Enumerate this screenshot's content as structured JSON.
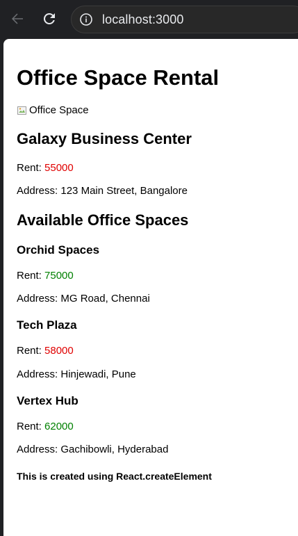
{
  "browser": {
    "url": "localhost:3000",
    "icons": {
      "back": "arrow-left-icon",
      "reload": "reload-icon",
      "site_info": "info-icon"
    }
  },
  "page": {
    "title": "Office Space Rental",
    "image_alt": "Office Space",
    "featured": {
      "name": "Galaxy Business Center",
      "rent_label": "Rent: ",
      "rent": "55000",
      "rent_color": "#e00000",
      "address_label": "Address: ",
      "address": "123 Main Street, Bangalore"
    },
    "available_heading": "Available Office Spaces",
    "offices": [
      {
        "name": "Orchid Spaces",
        "rent_label": "Rent: ",
        "rent": "75000",
        "rent_color": "#008000",
        "address_label": "Address: ",
        "address": "MG Road, Chennai"
      },
      {
        "name": "Tech Plaza",
        "rent_label": "Rent: ",
        "rent": "58000",
        "rent_color": "#e00000",
        "address_label": "Address: ",
        "address": "Hinjewadi, Pune"
      },
      {
        "name": "Vertex Hub",
        "rent_label": "Rent: ",
        "rent": "62000",
        "rent_color": "#008000",
        "address_label": "Address: ",
        "address": "Gachibowli, Hyderabad"
      }
    ],
    "footer_note": "This is created using React.createElement"
  }
}
